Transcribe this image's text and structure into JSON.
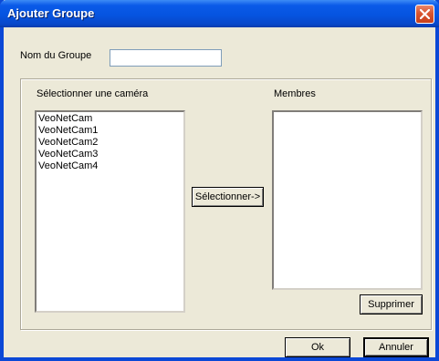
{
  "window": {
    "title": "Ajouter Groupe"
  },
  "form": {
    "group_name_label": "Nom du Groupe",
    "group_name_value": ""
  },
  "cameras": {
    "header": "Sélectionner une caméra",
    "items": [
      "VeoNetCam",
      "VeoNetCam1",
      "VeoNetCam2",
      "VeoNetCam3",
      "VeoNetCam4"
    ]
  },
  "members": {
    "header": "Membres",
    "items": []
  },
  "buttons": {
    "select": "Sélectionner->",
    "remove": "Supprimer",
    "ok": "Ok",
    "cancel": "Annuler"
  },
  "icons": {
    "close": "close-icon"
  }
}
